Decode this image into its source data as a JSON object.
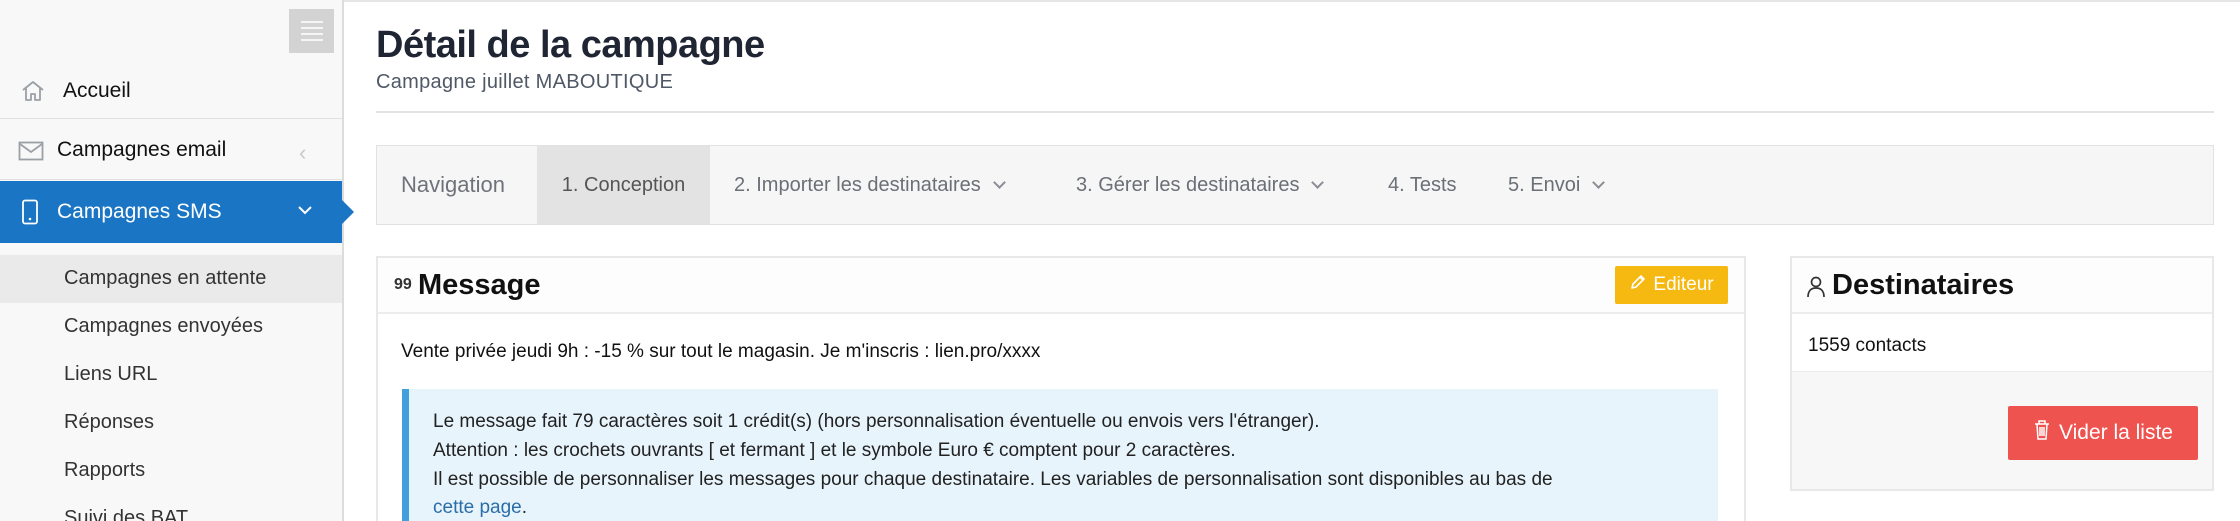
{
  "sidebar": {
    "menu_toggle": "menu",
    "items": [
      {
        "label": "Accueil",
        "icon": "home-icon"
      },
      {
        "label": "Campagnes email",
        "icon": "envelope-icon"
      },
      {
        "label": "Campagnes SMS",
        "icon": "mobile-icon"
      }
    ],
    "sub_items": [
      {
        "label": "Campagnes en attente"
      },
      {
        "label": "Campagnes envoyées"
      },
      {
        "label": "Liens URL"
      },
      {
        "label": "Réponses"
      },
      {
        "label": "Rapports"
      },
      {
        "label": "Suivi des BAT"
      }
    ],
    "active_color": "#1a76c5"
  },
  "header": {
    "title": "Détail de la campagne",
    "subtitle": "Campagne juillet MABOUTIQUE"
  },
  "steps": {
    "nav_label": "Navigation",
    "items": [
      {
        "label": "1. Conception"
      },
      {
        "label": "2. Importer les destinataires"
      },
      {
        "label": "3. Gérer les destinataires"
      },
      {
        "label": "4. Tests"
      },
      {
        "label": "5. Envoi"
      }
    ]
  },
  "message_panel": {
    "title": "Message",
    "quote_icon": "99",
    "editor_button": "Editeur",
    "editor_color": "#f5b912",
    "text": "Vente privée jeudi 9h : -15 % sur tout le magasin. Je m'inscris : lien.pro/xxxx",
    "info": {
      "line1": "Le message fait 79 caractères soit 1 crédit(s) (hors personnalisation éventuelle ou envois vers l'étranger).",
      "line2": "Attention : les crochets ouvrants [ et fermant ] et le symbole Euro € comptent pour 2 caractères.",
      "line3": "Il est possible de personnaliser les messages pour chaque destinataire. Les variables de personnalisation sont disponibles au bas de",
      "link": "cette page",
      "after_link": "."
    }
  },
  "recipients_panel": {
    "title": "Destinataires",
    "count": "1559 contacts",
    "clear_button": "Vider la liste",
    "clear_color": "#ef5350"
  }
}
